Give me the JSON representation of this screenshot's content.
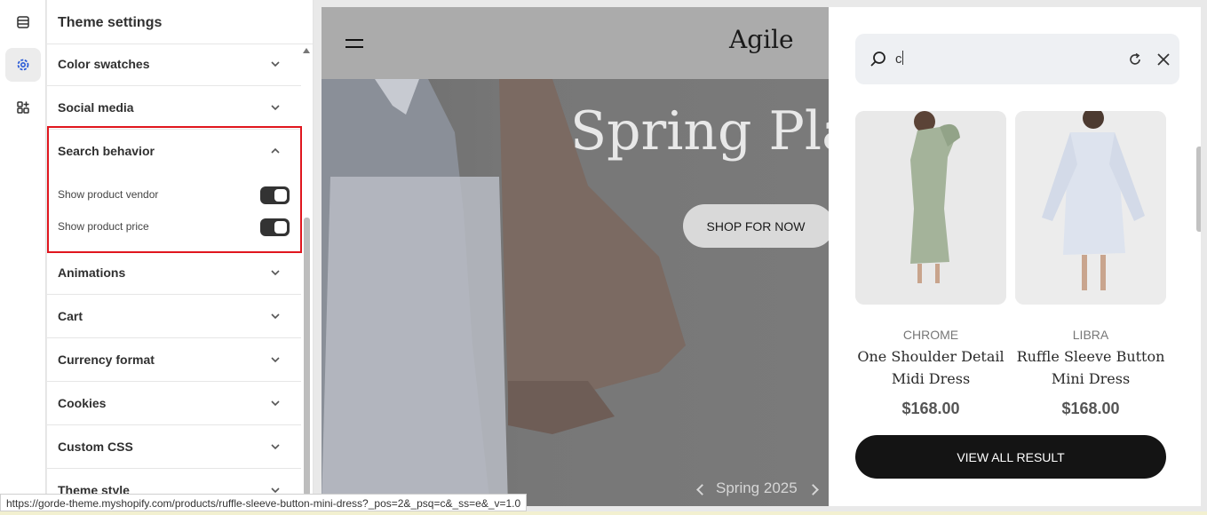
{
  "sidebar": {
    "title": "Theme settings",
    "sections": [
      {
        "label": "Color swatches"
      },
      {
        "label": "Social media"
      },
      {
        "label": "Search behavior"
      },
      {
        "label": "Animations"
      },
      {
        "label": "Cart"
      },
      {
        "label": "Currency format"
      },
      {
        "label": "Cookies"
      },
      {
        "label": "Custom CSS"
      },
      {
        "label": "Theme style"
      }
    ],
    "search_behavior": {
      "show_vendor_label": "Show product vendor",
      "show_vendor_on": true,
      "show_price_label": "Show product price",
      "show_price_on": true
    }
  },
  "store": {
    "logo": "Agile",
    "hero_title": "Spring Pla",
    "shop_button": "SHOP FOR NOW",
    "slide_label": "Spring 2025"
  },
  "search": {
    "query": "c",
    "products": [
      {
        "vendor": "CHROME",
        "name_line1": "One Shoulder Detail",
        "name_line2": "Midi Dress",
        "price": "$168.00"
      },
      {
        "vendor": "LIBRA",
        "name_line1": "Ruffle Sleeve Button",
        "name_line2": "Mini Dress",
        "price": "$168.00"
      }
    ],
    "view_all": "VIEW ALL RESULT"
  },
  "status_url": "https://gorde-theme.myshopify.com/products/ruffle-sleeve-button-mini-dress?_pos=2&_psq=c&_ss=e&_v=1.0",
  "colors": {
    "highlight": "#e0161e",
    "toggle_on": "#333333",
    "cta_bg": "#141414"
  }
}
